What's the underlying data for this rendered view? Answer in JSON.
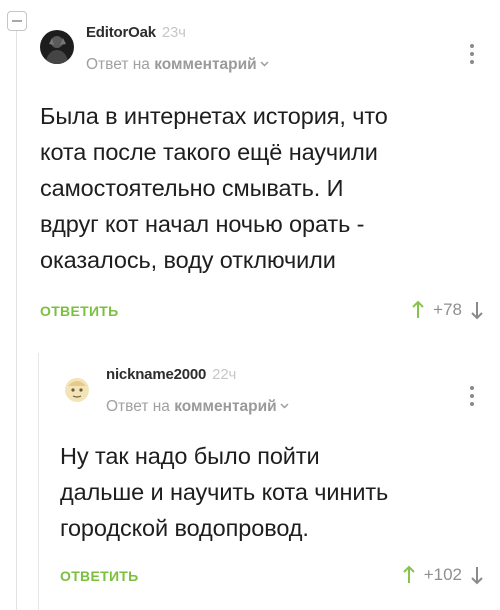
{
  "comments": [
    {
      "username": "EditorOak",
      "time": "23ч",
      "reply_prefix": "Ответ на ",
      "reply_keyword": "комментарий",
      "text": "Была в интернетах история, что\nкота после такого ещё научили\nсамостоятельно смывать. И\nвдруг кот начал ночью орать -\nоказалось, воду отключили",
      "reply_label": "ОТВЕТИТЬ",
      "rating": "+78"
    },
    {
      "username": "nickname2000",
      "time": "22ч",
      "reply_prefix": "Ответ на ",
      "reply_keyword": "комментарий",
      "text": "Ну так надо было пойти\nдальше и научить кота чинить\nгородской водопровод.",
      "reply_label": "ОТВЕТИТЬ",
      "rating": "+102"
    }
  ],
  "colors": {
    "accent_green": "#7bbf3e",
    "upvote_green": "#86c34a",
    "muted": "#a0a0a0"
  },
  "icons": [
    "collapse-icon",
    "avatar-image",
    "more-options-icon",
    "chevron-down-icon",
    "upvote-arrow-icon",
    "downvote-arrow-icon"
  ]
}
